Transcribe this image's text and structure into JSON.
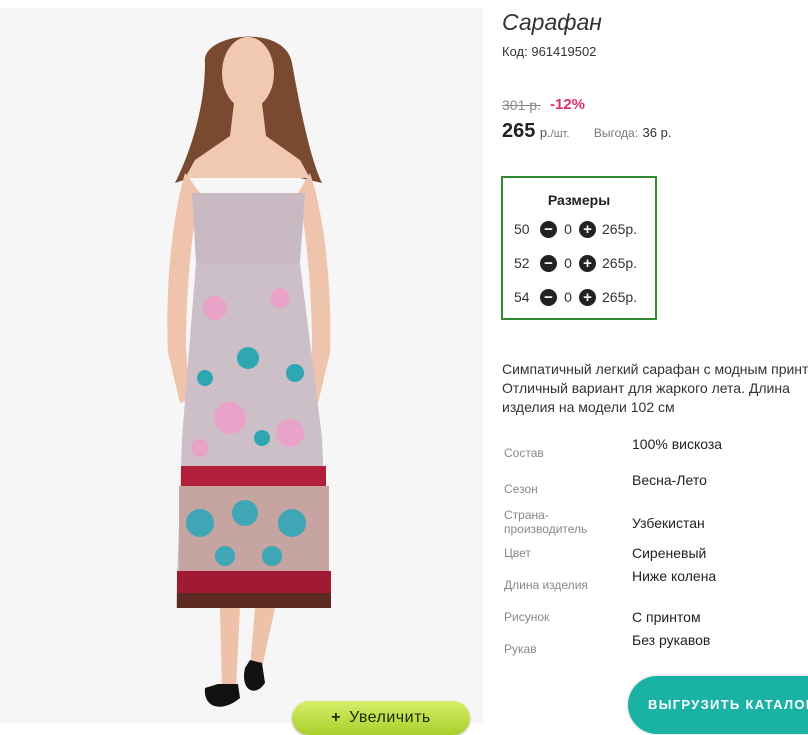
{
  "product": {
    "title": "Сарафан",
    "code_label": "Код:",
    "code": "961419502",
    "old_price": "301 р.",
    "discount": "-12%",
    "price": "265",
    "price_unit": "р.",
    "price_per": "/шт.",
    "saving_label": "Выгода:",
    "saving": "36 р.",
    "description": "Симпатичный легкий сарафан с модным принт Отличный вариант для жаркого лета. Длина изделия на модели 102 см"
  },
  "sizes": {
    "title": "Размеры",
    "rows": [
      {
        "size": "50",
        "qty": "0",
        "price": "265р."
      },
      {
        "size": "52",
        "qty": "0",
        "price": "265р."
      },
      {
        "size": "54",
        "qty": "0",
        "price": "265р."
      }
    ],
    "minus_icon": "minus-circle-icon",
    "plus_icon": "plus-circle-icon"
  },
  "specs": [
    {
      "label": "Состав",
      "value": "100% вискоза"
    },
    {
      "label": "Сезон",
      "value": "Весна-Лето"
    },
    {
      "label": "Страна-производитель",
      "value": "Узбекистан"
    },
    {
      "label": "Цвет",
      "value": "Сиреневый"
    },
    {
      "label": "Длина изделия",
      "value": "Ниже колена"
    },
    {
      "label": "Рисунок",
      "value": "С принтом"
    },
    {
      "label": "Рукав",
      "value": "Без рукавов"
    }
  ],
  "buttons": {
    "zoom_icon": "+",
    "zoom": "Увеличить",
    "unload": "ВЫГРУЗИТЬ КАТАЛОГ"
  },
  "colors": {
    "accent_green": "#2e8b2e",
    "discount": "#e0306a",
    "teal": "#1ab2a4",
    "zoom_green": "#b5d83a"
  }
}
